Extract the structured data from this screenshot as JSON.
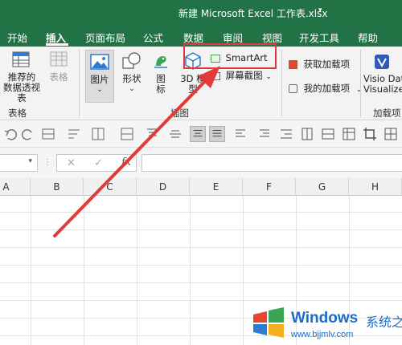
{
  "window": {
    "title": "新建 Microsoft Excel 工作表.xlsx",
    "title_caret": "▾"
  },
  "menu": {
    "tabs": [
      "开始",
      "插入",
      "页面布局",
      "公式",
      "数据",
      "审阅",
      "视图",
      "开发工具",
      "帮助"
    ],
    "active": "插入"
  },
  "ribbon": {
    "pivot": {
      "line1": "推荐的",
      "line2": "数据透视表"
    },
    "table": "表格",
    "picture": "图片",
    "shapes": "形状",
    "icons": {
      "line1": "图",
      "line2": "标"
    },
    "model3d": {
      "line1": "3D 模",
      "line2": "型"
    },
    "smartart": "SmartArt",
    "screenshot": "屏幕截图",
    "get_addins": "获取加载项",
    "my_addins": "我的加载项",
    "visio": {
      "line1": "Visio Dat",
      "line2": "Visualize"
    },
    "groups": {
      "tables": "表格",
      "illustrations": "插图",
      "addins": "加载项"
    }
  },
  "formula_bar": {
    "name_box": "",
    "formula": ""
  },
  "grid": {
    "columns": [
      "A",
      "B",
      "C",
      "D",
      "E",
      "F",
      "G",
      "H"
    ]
  },
  "watermark": {
    "brand": "Windows",
    "brand_cn": "系统之家",
    "url": "www.bjjmlv.com"
  },
  "colors": {
    "excel_green": "#217346",
    "annotation_red": "#e03a3a",
    "watermark_blue": "#1a6bcc"
  }
}
